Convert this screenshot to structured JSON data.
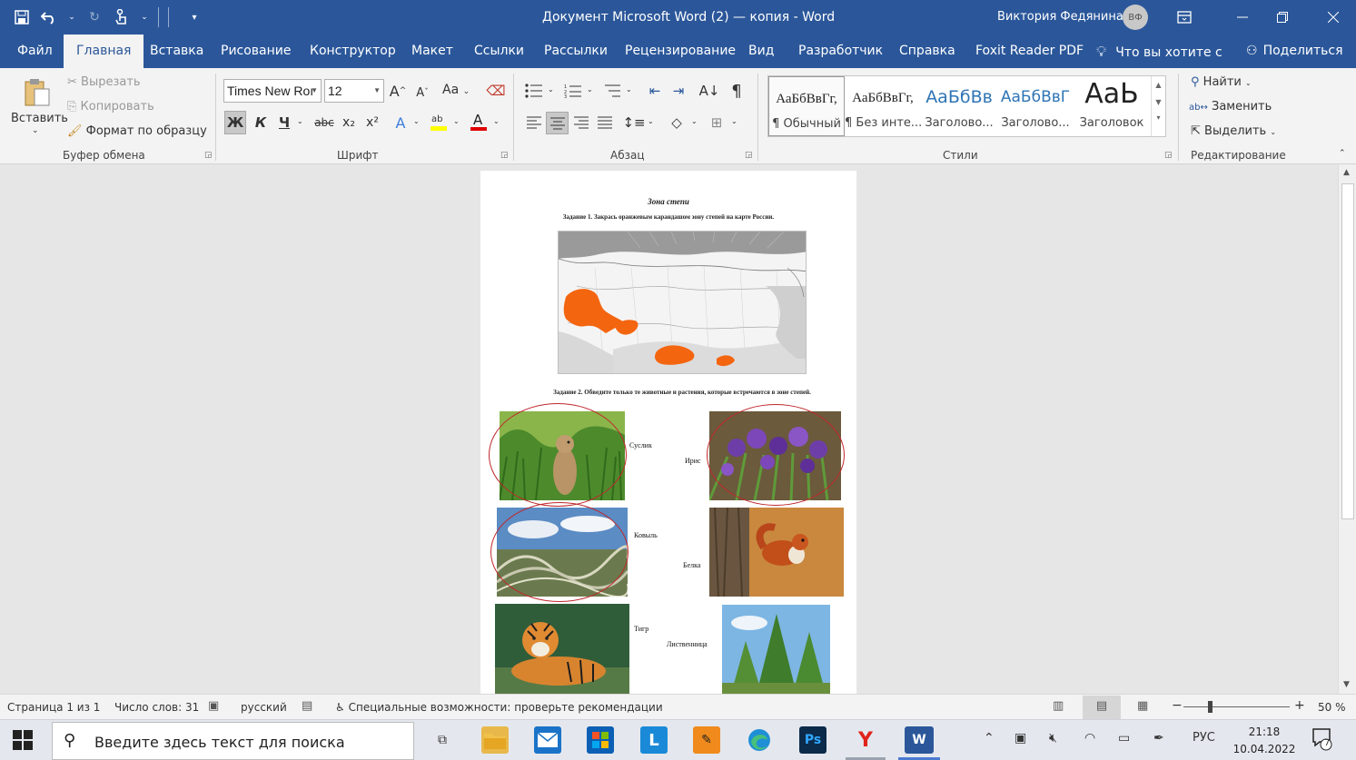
{
  "colors": {
    "word_blue": "#2b579a",
    "ribbon_bg": "#f3f3f3",
    "steppe_orange": "#f4650f",
    "ring_red": "#c0282c"
  },
  "titlebar": {
    "doc_title": "Документ Microsoft Word (2) — копия  -  Word",
    "user_name": "Виктория Федянина",
    "user_initials": "ВФ",
    "icons": [
      "save-icon",
      "undo-icon",
      "redo-icon",
      "touch-mode-icon",
      "customize-qat-icon",
      "ribbon-display-icon",
      "minimize-icon",
      "restore-icon",
      "close-icon"
    ]
  },
  "tabs": [
    {
      "label": "Файл"
    },
    {
      "label": "Главная"
    },
    {
      "label": "Вставка"
    },
    {
      "label": "Рисование"
    },
    {
      "label": "Конструктор"
    },
    {
      "label": "Макет"
    },
    {
      "label": "Ссылки"
    },
    {
      "label": "Рассылки"
    },
    {
      "label": "Рецензирование"
    },
    {
      "label": "Вид"
    },
    {
      "label": "Разработчик"
    },
    {
      "label": "Справка"
    },
    {
      "label": "Foxit Reader PDF"
    }
  ],
  "tell_me": "Что вы хотите с",
  "share": "Поделиться",
  "clipboard": {
    "paste": "Вставить",
    "cut": "Вырезать",
    "copy": "Копировать",
    "format_painter": "Формат по образцу",
    "group": "Буфер обмена"
  },
  "font": {
    "name": "Times New Roı",
    "size": "12",
    "group": "Шрифт",
    "bold": "Ж",
    "italic": "К",
    "underline": "Ч",
    "strike": "abc",
    "sub": "x₂",
    "sup": "x²",
    "grow": "A^",
    "shrink": "Aˇ",
    "case": "Aa"
  },
  "paragraph": {
    "group": "Абзац",
    "pilcrow": "¶"
  },
  "styles": {
    "group": "Стили",
    "items": [
      {
        "sample": "АаБбВвГг,",
        "name": "¶ Обычный"
      },
      {
        "sample": "АаБбВвГг,",
        "name": "¶ Без инте..."
      },
      {
        "sample": "АаБбВв",
        "name": "Заголово..."
      },
      {
        "sample": "АаБбВвГ",
        "name": "Заголово..."
      },
      {
        "sample": "АаЬ",
        "name": "Заголовок"
      }
    ]
  },
  "editing": {
    "find": "Найти",
    "replace": "Заменить",
    "select": "Выделить",
    "group": "Редактирование"
  },
  "document": {
    "title": "Зона степи",
    "task1": "Задание 1. Закрась оранжевым карандашом зону степей на карте России.",
    "task2": "Задание 2. Обведите только те животные и растения, которые встречаются в зоне степей.",
    "items": [
      {
        "caption": "Суслик",
        "circled": true
      },
      {
        "caption": "Ирис",
        "circled": true
      },
      {
        "caption": "Ковыль",
        "circled": true
      },
      {
        "caption": "Белка",
        "circled": false
      },
      {
        "caption": "Тигр",
        "circled": false
      },
      {
        "caption": "Лиственница",
        "circled": false
      }
    ]
  },
  "status": {
    "page": "Страница 1 из 1",
    "words": "Число слов: 31",
    "language": "русский",
    "accessibility": "Специальные возможности: проверьте рекомендации",
    "zoom": "50 %"
  },
  "taskbar": {
    "search_placeholder": "Введите здесь текст для поиска",
    "lang": "РУС",
    "time": "21:18",
    "date": "10.04.2022",
    "notifications": "7"
  }
}
